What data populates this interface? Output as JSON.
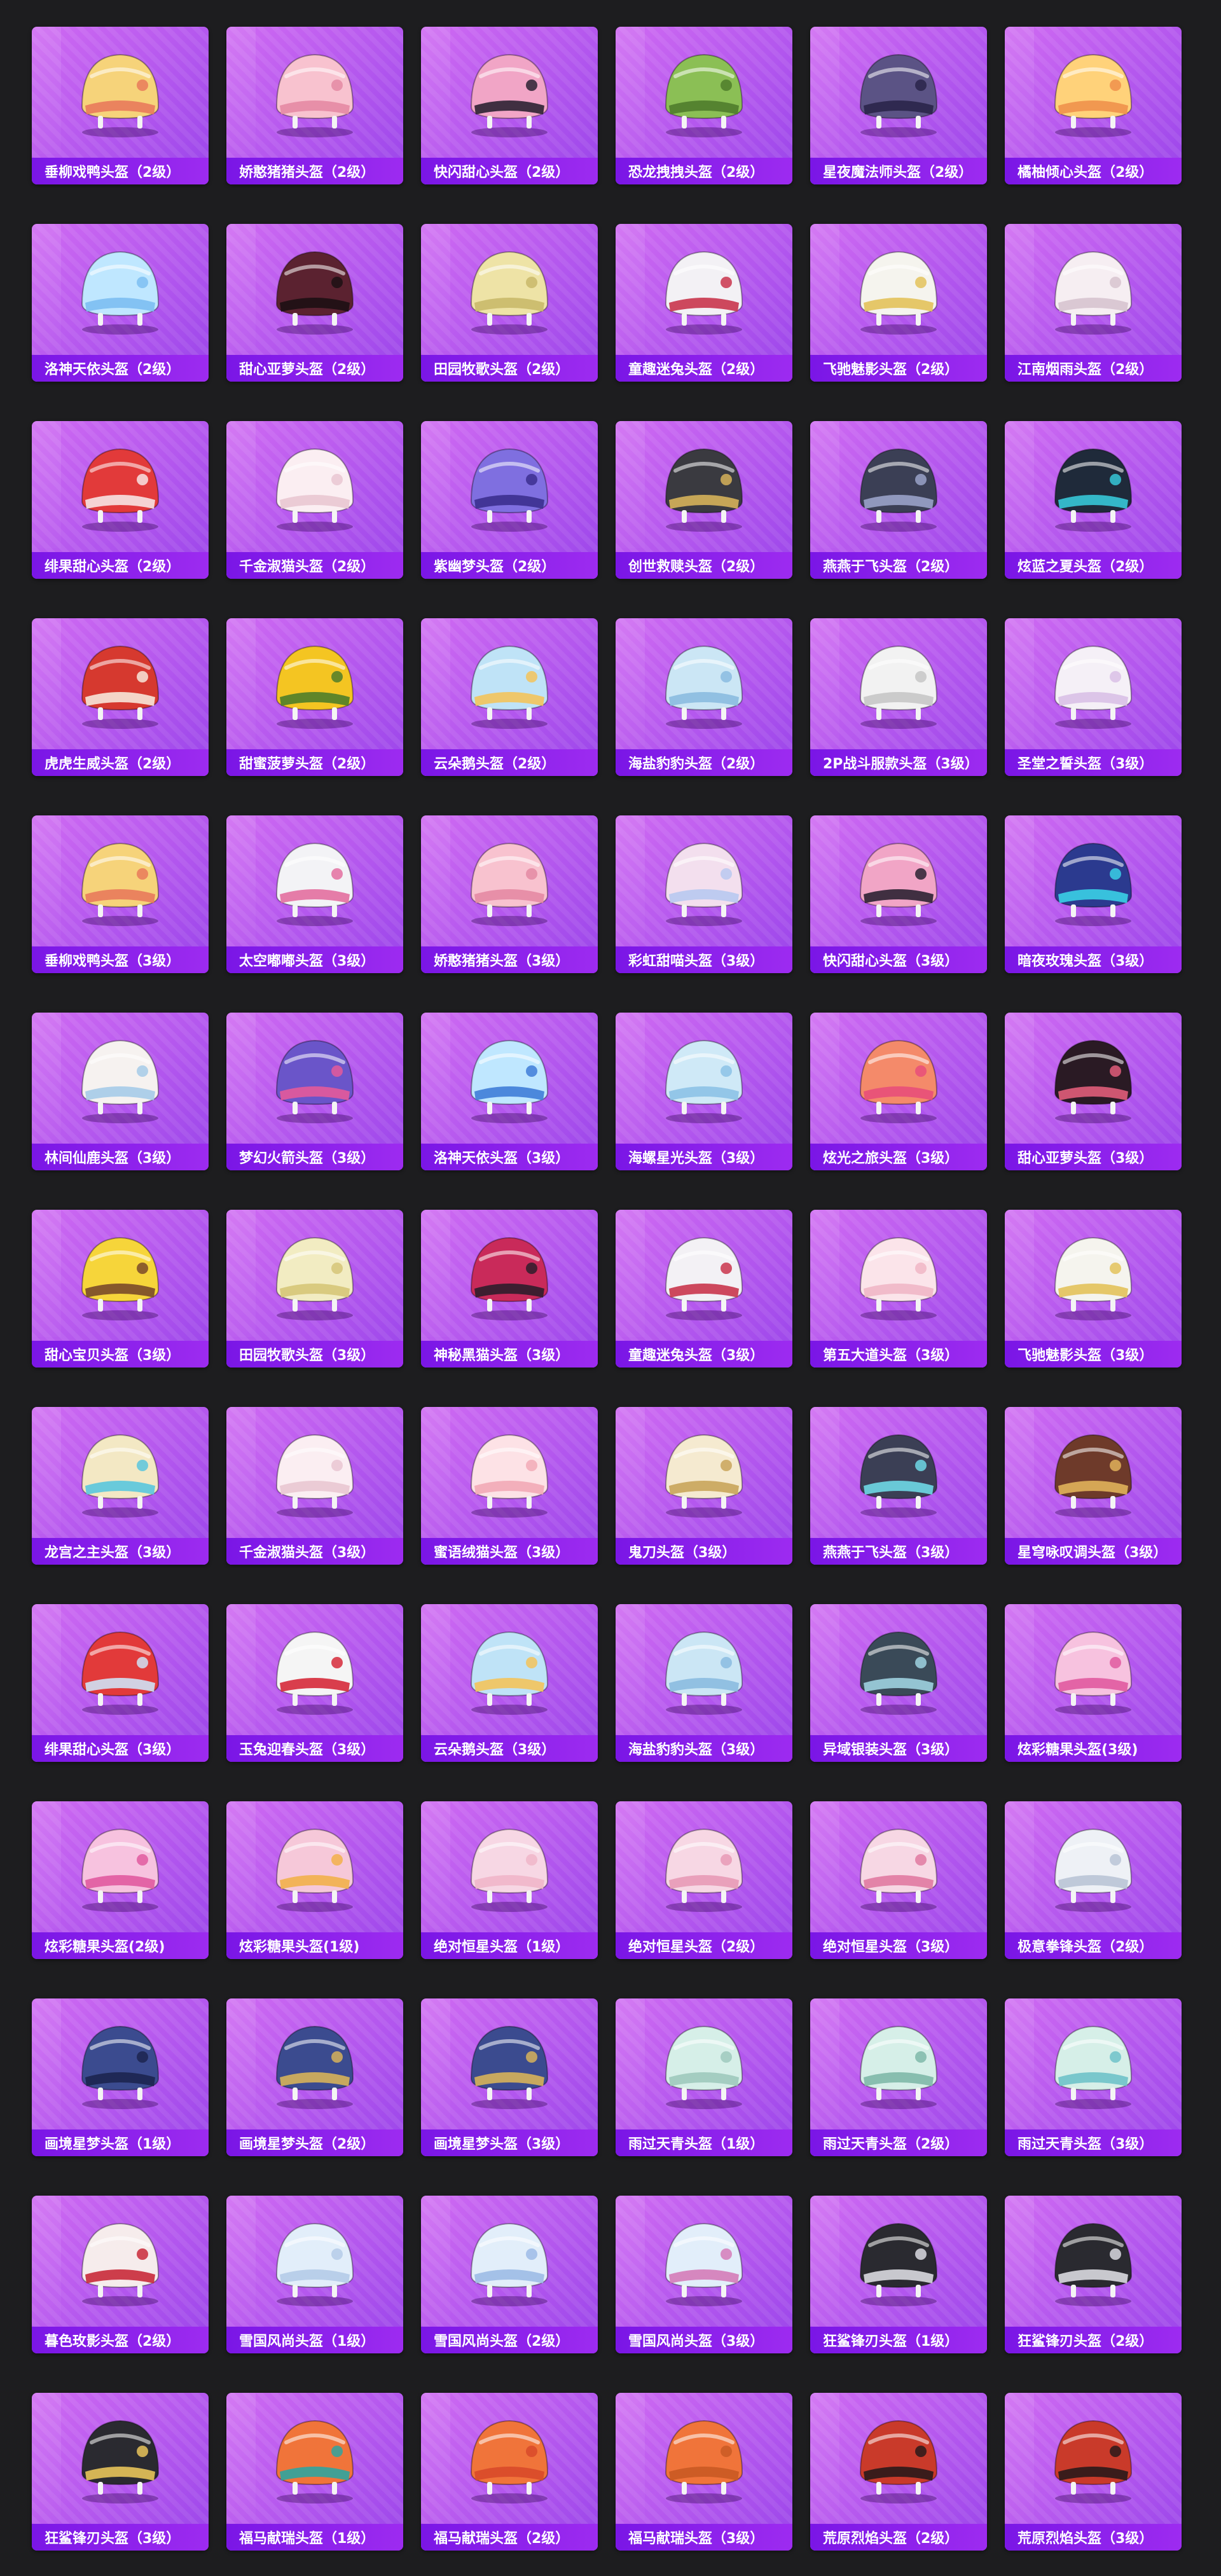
{
  "items": [
    {
      "label": "垂柳戏鸭头盔（2级）",
      "icon": "duck-helmet-icon",
      "colors": [
        "#f6d37a",
        "#e97a5b"
      ]
    },
    {
      "label": "娇憨猪猪头盔（2级）",
      "icon": "pig-helmet-icon",
      "colors": [
        "#f8c2cf",
        "#e48aa3"
      ]
    },
    {
      "label": "快闪甜心头盔（2级）",
      "icon": "helmet-icon",
      "colors": [
        "#f1a5c6",
        "#2c2232"
      ]
    },
    {
      "label": "恐龙拽拽头盔（2级）",
      "icon": "dinosaur-helmet-icon",
      "colors": [
        "#8bbf55",
        "#4f7c2c"
      ]
    },
    {
      "label": "星夜魔法师头盔（2级）",
      "icon": "wizard-helmet-icon",
      "colors": [
        "#5b5385",
        "#2a254a"
      ]
    },
    {
      "label": "橘柚倾心头盔（2级）",
      "icon": "orange-helmet-icon",
      "colors": [
        "#ffd27a",
        "#f0914b"
      ]
    },
    {
      "label": "洛神天依头盔（2级）",
      "icon": "bunny-helmet-icon",
      "colors": [
        "#bfe7ff",
        "#7cbef2"
      ]
    },
    {
      "label": "甜心亚萝头盔（2级）",
      "icon": "cat-helmet-icon",
      "colors": [
        "#5b2230",
        "#1d1014"
      ]
    },
    {
      "label": "田园牧歌头盔（2级）",
      "icon": "leaf-helmet-icon",
      "colors": [
        "#eee3a6",
        "#c9b96a"
      ]
    },
    {
      "label": "童趣迷兔头盔（2级）",
      "icon": "bunny-helmet-icon",
      "colors": [
        "#f3f1f5",
        "#c9354c"
      ]
    },
    {
      "label": "飞驰魅影头盔（2级）",
      "icon": "winged-helmet-icon",
      "colors": [
        "#f5f4ee",
        "#e3c25a"
      ]
    },
    {
      "label": "江南烟雨头盔（2级）",
      "icon": "helmet-icon",
      "colors": [
        "#f6eef2",
        "#d7c3cf"
      ]
    },
    {
      "label": "绯果甜心头盔（2级）",
      "icon": "strawberry-helmet-icon",
      "colors": [
        "#e23a3a",
        "#f7e4e4"
      ]
    },
    {
      "label": "千金淑猫头盔（2级）",
      "icon": "cat-helmet-icon",
      "colors": [
        "#fbeef2",
        "#e9c6d2"
      ]
    },
    {
      "label": "紫幽梦头盔（2级）",
      "icon": "cat-helmet-icon",
      "colors": [
        "#7f6fe0",
        "#3c2f8f"
      ]
    },
    {
      "label": "创世救赎头盔（2级）",
      "icon": "helmet-icon",
      "colors": [
        "#3a3a40",
        "#d6b25a"
      ]
    },
    {
      "label": "燕燕于飞头盔（2级）",
      "icon": "helmet-icon",
      "colors": [
        "#3b3f55",
        "#9aa2c9"
      ]
    },
    {
      "label": "炫蓝之夏头盔（2级）",
      "icon": "helmet-icon",
      "colors": [
        "#1f2a3a",
        "#36c7d8"
      ]
    },
    {
      "label": "虎虎生威头盔（2级）",
      "icon": "tiger-helmet-icon",
      "colors": [
        "#d6392f",
        "#f7e7d9"
      ]
    },
    {
      "label": "甜蜜菠萝头盔（2级）",
      "icon": "pineapple-helmet-icon",
      "colors": [
        "#f4c522",
        "#4f7d2a"
      ]
    },
    {
      "label": "云朵鹅头盔（2级）",
      "icon": "goose-helmet-icon",
      "colors": [
        "#bfe3f7",
        "#f3c35b"
      ]
    },
    {
      "label": "海盐豹豹头盔（2级）",
      "icon": "leopard-helmet-icon",
      "colors": [
        "#cbe6f5",
        "#8bbbe0"
      ]
    },
    {
      "label": "2P战斗服款头盔（3级）",
      "icon": "combat-helmet-icon",
      "colors": [
        "#f2f2f2",
        "#c7c7c7"
      ]
    },
    {
      "label": "圣堂之誓头盔（3级）",
      "icon": "winged-helmet-icon",
      "colors": [
        "#f5f0f7",
        "#d9c0e6"
      ]
    },
    {
      "label": "垂柳戏鸭头盔（3级）",
      "icon": "duck-helmet-icon",
      "colors": [
        "#f6d37a",
        "#e97a5b"
      ]
    },
    {
      "label": "太空嘟嘟头盔（3级）",
      "icon": "bunny-helmet-icon",
      "colors": [
        "#f3f3f6",
        "#e36fa0"
      ]
    },
    {
      "label": "娇憨猪猪头盔（3级）",
      "icon": "pig-helmet-icon",
      "colors": [
        "#f8c2cf",
        "#e48aa3"
      ]
    },
    {
      "label": "彩虹甜喵头盔（3级）",
      "icon": "cat-helmet-icon",
      "colors": [
        "#f3dfee",
        "#b8c9f0"
      ]
    },
    {
      "label": "快闪甜心头盔（3级）",
      "icon": "combat-helmet-icon",
      "colors": [
        "#f1a5c6",
        "#2c2232"
      ]
    },
    {
      "label": "暗夜玫瑰头盔（3级）",
      "icon": "rose-helmet-icon",
      "colors": [
        "#2b3a8f",
        "#3ad0e6"
      ]
    },
    {
      "label": "林间仙鹿头盔（3级）",
      "icon": "deer-helmet-icon",
      "colors": [
        "#f6f2f0",
        "#a6cbe8"
      ]
    },
    {
      "label": "梦幻火箭头盔（3级）",
      "icon": "rocket-helmet-icon",
      "colors": [
        "#6a55c9",
        "#e45a9a"
      ]
    },
    {
      "label": "洛神天依头盔（3级）",
      "icon": "bunny-helmet-icon",
      "colors": [
        "#bfe7ff",
        "#3f7dd8"
      ]
    },
    {
      "label": "海螺星光头盔（3级）",
      "icon": "combat-helmet-icon",
      "colors": [
        "#cfe9f7",
        "#8cc2e6"
      ]
    },
    {
      "label": "炫光之旅头盔（3级）",
      "icon": "combat-helmet-icon",
      "colors": [
        "#f48a6a",
        "#e84e7a"
      ]
    },
    {
      "label": "甜心亚萝头盔（3级）",
      "icon": "cat-helmet-icon",
      "colors": [
        "#2a1a24",
        "#e05d7a"
      ]
    },
    {
      "label": "甜心宝贝头盔（3级）",
      "icon": "chick-helmet-icon",
      "colors": [
        "#f6d53a",
        "#7a4a2a"
      ]
    },
    {
      "label": "田园牧歌头盔（3级）",
      "icon": "flower-helmet-icon",
      "colors": [
        "#f2ecc2",
        "#d6c678"
      ]
    },
    {
      "label": "神秘黑猫头盔（3级）",
      "icon": "cat-helmet-icon",
      "colors": [
        "#c92a5a",
        "#2e1d2b"
      ]
    },
    {
      "label": "童趣迷兔头盔（3级）",
      "icon": "bunny-helmet-icon",
      "colors": [
        "#f3f1f5",
        "#c9354c"
      ]
    },
    {
      "label": "第五大道头盔（3级）",
      "icon": "combat-helmet-icon",
      "colors": [
        "#fbe4ea",
        "#f0b6c6"
      ]
    },
    {
      "label": "飞驰魅影头盔（3级）",
      "icon": "combat-helmet-icon",
      "colors": [
        "#f5f4ee",
        "#e3c25a"
      ]
    },
    {
      "label": "龙宫之主头盔（3级）",
      "icon": "dragon-helmet-icon",
      "colors": [
        "#f3e8c4",
        "#5ac6de"
      ]
    },
    {
      "label": "千金淑猫头盔（3级）",
      "icon": "cat-helmet-icon",
      "colors": [
        "#fbeef2",
        "#e9c6d2"
      ]
    },
    {
      "label": "蜜语绒猫头盔（3级）",
      "icon": "cat-helmet-icon",
      "colors": [
        "#fde2e6",
        "#f2aab6"
      ]
    },
    {
      "label": "鬼刀头盔（3级）",
      "icon": "ornate-helmet-icon",
      "colors": [
        "#f5ead0",
        "#c9a55a"
      ]
    },
    {
      "label": "燕燕于飞头盔（3级）",
      "icon": "combat-helmet-icon",
      "colors": [
        "#3b3f55",
        "#6fd8e6"
      ]
    },
    {
      "label": "星穹咏叹调头盔（3级）",
      "icon": "ornate-helmet-icon",
      "colors": [
        "#6e3a2a",
        "#e0b25a"
      ]
    },
    {
      "label": "绯果甜心头盔（3级）",
      "icon": "strawberry-helmet-icon",
      "colors": [
        "#e23a3a",
        "#cfe2f5"
      ]
    },
    {
      "label": "玉兔迎春头盔（3级）",
      "icon": "bunny-helmet-icon",
      "colors": [
        "#f5f5f5",
        "#d62a3a"
      ]
    },
    {
      "label": "云朵鹅头盔（3级）",
      "icon": "goose-helmet-icon",
      "colors": [
        "#bfe3f7",
        "#f3c35b"
      ]
    },
    {
      "label": "海盐豹豹头盔（3级）",
      "icon": "leopard-helmet-icon",
      "colors": [
        "#cbe6f5",
        "#8bbbe0"
      ]
    },
    {
      "label": "异域银装头盔（3级）",
      "icon": "combat-helmet-icon",
      "colors": [
        "#3a4a58",
        "#9fd2e0"
      ]
    },
    {
      "label": "炫彩糖果头盔(3级)",
      "icon": "candy-helmet-icon",
      "colors": [
        "#f7c2df",
        "#e05aa0"
      ]
    },
    {
      "label": "炫彩糖果头盔(2级)",
      "icon": "candy-helmet-icon",
      "colors": [
        "#f7c2df",
        "#e05aa0"
      ]
    },
    {
      "label": "炫彩糖果头盔(1级)",
      "icon": "helmet-icon",
      "colors": [
        "#f6c8d9",
        "#f2b04a"
      ]
    },
    {
      "label": "绝对恒星头盔（1级）",
      "icon": "helmet-icon",
      "colors": [
        "#f7d7e4",
        "#f0b6c9"
      ]
    },
    {
      "label": "绝对恒星头盔（2级）",
      "icon": "helmet-icon",
      "colors": [
        "#f7d7e4",
        "#e79ab6"
      ]
    },
    {
      "label": "绝对恒星头盔（3级）",
      "icon": "combat-helmet-icon",
      "colors": [
        "#f7d7e4",
        "#e07aa1"
      ]
    },
    {
      "label": "极意拳锋头盔（2级）",
      "icon": "helmet-icon",
      "colors": [
        "#eef1f6",
        "#b9c4d6"
      ]
    },
    {
      "label": "画境星梦头盔（1级）",
      "icon": "helmet-icon",
      "colors": [
        "#3b4b8f",
        "#1d2550"
      ]
    },
    {
      "label": "画境星梦头盔（2级）",
      "icon": "helmet-icon",
      "colors": [
        "#3b4b8f",
        "#d7b25a"
      ]
    },
    {
      "label": "画境星梦头盔（3级）",
      "icon": "combat-helmet-icon",
      "colors": [
        "#3b4b8f",
        "#d7b25a"
      ]
    },
    {
      "label": "雨过天青头盔（1级）",
      "icon": "helmet-icon",
      "colors": [
        "#d6efe8",
        "#9fc9bd"
      ]
    },
    {
      "label": "雨过天青头盔（2级）",
      "icon": "helmet-icon",
      "colors": [
        "#d6efe8",
        "#7fb8a9"
      ]
    },
    {
      "label": "雨过天青头盔（3级）",
      "icon": "combat-helmet-icon",
      "colors": [
        "#d6efe8",
        "#6fc2c9"
      ]
    },
    {
      "label": "暮色玫影头盔（2级）",
      "icon": "rose-helmet-icon",
      "colors": [
        "#f6ecec",
        "#c92a3a"
      ]
    },
    {
      "label": "雪国风尚头盔（1级）",
      "icon": "helmet-icon",
      "colors": [
        "#e2eefa",
        "#b5cbe8"
      ]
    },
    {
      "label": "雪国风尚头盔（2级）",
      "icon": "helmet-icon",
      "colors": [
        "#e2eefa",
        "#9dbbe6"
      ]
    },
    {
      "label": "雪国风尚头盔（3级）",
      "icon": "combat-helmet-icon",
      "colors": [
        "#e2eefa",
        "#d57bb8"
      ]
    },
    {
      "label": "狂鲨锋刃头盔（1级）",
      "icon": "shark-helmet-icon",
      "colors": [
        "#2a2a30",
        "#d9d9e0"
      ]
    },
    {
      "label": "狂鲨锋刃头盔（2级）",
      "icon": "shark-helmet-icon",
      "colors": [
        "#2a2a30",
        "#d9d9e0"
      ]
    },
    {
      "label": "狂鲨锋刃头盔（3级）",
      "icon": "shark-helmet-icon",
      "colors": [
        "#2a2a30",
        "#e7c35a"
      ]
    },
    {
      "label": "福马献瑞头盔（1级）",
      "icon": "helmet-icon",
      "colors": [
        "#f0743a",
        "#2fa5a0"
      ]
    },
    {
      "label": "福马献瑞头盔（2级）",
      "icon": "helmet-icon",
      "colors": [
        "#f0743a",
        "#d84a2a"
      ]
    },
    {
      "label": "福马献瑞头盔（3级）",
      "icon": "horse-helmet-icon",
      "colors": [
        "#f0743a",
        "#c95a24"
      ]
    },
    {
      "label": "荒原烈焰头盔（2级）",
      "icon": "flame-helmet-icon",
      "colors": [
        "#c93a2a",
        "#2a1a1a"
      ]
    },
    {
      "label": "荒原烈焰头盔（3级）",
      "icon": "flame-helmet-icon",
      "colors": [
        "#c93a2a",
        "#2a1a1a"
      ]
    }
  ]
}
